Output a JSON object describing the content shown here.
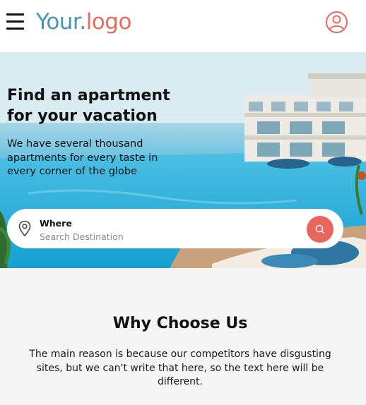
{
  "header": {
    "logo_part1": "Your.",
    "logo_part2": "logo",
    "menu_icon": "hamburger-menu-icon",
    "profile_icon": "user-profile-icon"
  },
  "hero": {
    "title": "Find an apartment for your vacation",
    "subtitle": "We have several thousand apartments for every taste in every corner of the globe",
    "background": "resort-infinity-pool-photo"
  },
  "search": {
    "label": "Where",
    "placeholder": "Search Destination",
    "value": "",
    "pin_icon": "location-pin-icon",
    "button_icon": "search-icon"
  },
  "why": {
    "title": "Why Choose Us",
    "text": "The main reason is because our competitors have disgusting sites, but we can't write that here, so the text here will be different."
  },
  "colors": {
    "logo_blue": "#4a95b4",
    "logo_coral": "#e56c61",
    "accent": "#e8665b",
    "section_bg": "#f5f5f5"
  }
}
